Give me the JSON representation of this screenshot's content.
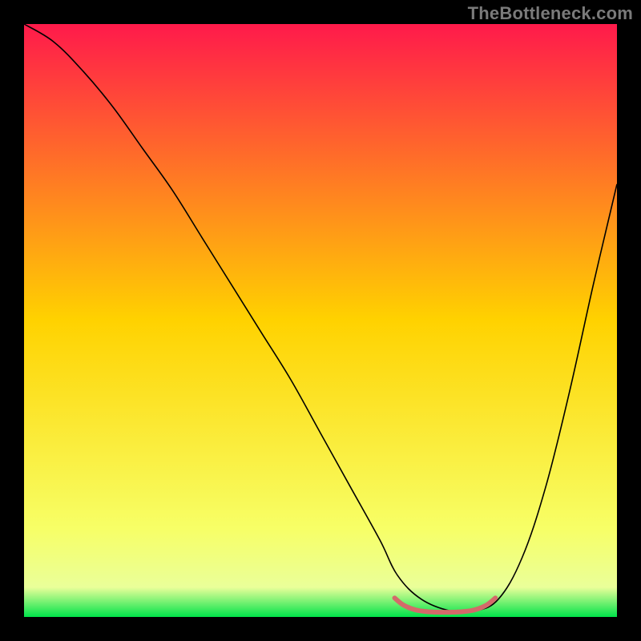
{
  "watermark": "TheBottleneck.com",
  "chart_data": {
    "type": "line",
    "title": "",
    "xlabel": "",
    "ylabel": "",
    "xlim": [
      0,
      100
    ],
    "ylim": [
      0,
      100
    ],
    "grid": false,
    "background_gradient": {
      "stops": [
        {
          "offset": 0.0,
          "color": "#ff1a4b"
        },
        {
          "offset": 0.5,
          "color": "#ffd200"
        },
        {
          "offset": 0.85,
          "color": "#f7ff66"
        },
        {
          "offset": 0.95,
          "color": "#eaff99"
        },
        {
          "offset": 1.0,
          "color": "#00e34a"
        }
      ]
    },
    "series": [
      {
        "name": "bottleneck-curve",
        "color": "#000000",
        "width": 1.6,
        "x": [
          0,
          5,
          10,
          15,
          20,
          25,
          30,
          35,
          40,
          45,
          50,
          55,
          60,
          63,
          67,
          72,
          76,
          80,
          84,
          88,
          92,
          96,
          100
        ],
        "y": [
          100,
          97,
          92,
          86,
          79,
          72,
          64,
          56,
          48,
          40,
          31,
          22,
          13,
          7,
          3,
          1,
          1,
          3,
          10,
          22,
          38,
          56,
          73
        ]
      },
      {
        "name": "optimal-zone-marker",
        "color": "#d46a6a",
        "width": 6,
        "x": [
          62.5,
          64,
          66,
          68,
          70,
          72,
          74,
          76,
          78,
          79.5
        ],
        "y": [
          3.2,
          2.0,
          1.2,
          0.9,
          0.8,
          0.8,
          0.9,
          1.2,
          2.0,
          3.2
        ]
      }
    ]
  }
}
